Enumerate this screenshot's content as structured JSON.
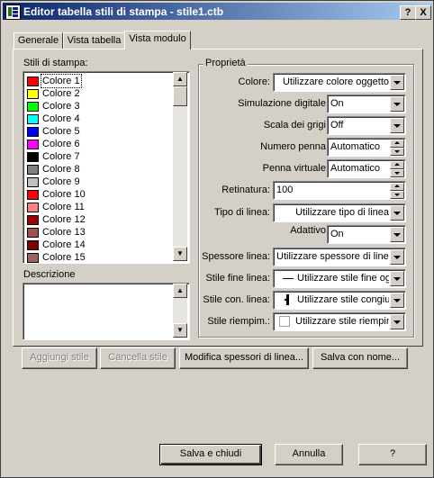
{
  "window": {
    "title": "Editor tabella stili di stampa - stile1.ctb",
    "help_button": "?",
    "close_button": "X"
  },
  "tabs": [
    {
      "label": "Generale"
    },
    {
      "label": "Vista tabella"
    },
    {
      "label": "Vista modulo"
    }
  ],
  "styles_list": {
    "label": "Stili di stampa:",
    "items": [
      {
        "label": "Colore 1",
        "color": "#ff0000",
        "selected": true
      },
      {
        "label": "Colore 2",
        "color": "#ffff00"
      },
      {
        "label": "Colore 3",
        "color": "#00ff00"
      },
      {
        "label": "Colore 4",
        "color": "#00ffff"
      },
      {
        "label": "Colore 5",
        "color": "#0000ff"
      },
      {
        "label": "Colore 6",
        "color": "#ff00ff"
      },
      {
        "label": "Colore 7",
        "color": "#000000"
      },
      {
        "label": "Colore 8",
        "color": "#808080"
      },
      {
        "label": "Colore 9",
        "color": "#c0c0c0"
      },
      {
        "label": "Colore 10",
        "color": "#ff0000"
      },
      {
        "label": "Colore 11",
        "color": "#ff8080"
      },
      {
        "label": "Colore 12",
        "color": "#a00000"
      },
      {
        "label": "Colore 13",
        "color": "#a05050"
      },
      {
        "label": "Colore 14",
        "color": "#800000"
      },
      {
        "label": "Colore 15",
        "color": "#a06060"
      }
    ]
  },
  "description": {
    "label": "Descrizione",
    "value": ""
  },
  "properties": {
    "group_title": "Proprietà",
    "color": {
      "label": "Colore:",
      "value": "Utilizzare colore oggetto"
    },
    "dithering": {
      "label": "Simulazione digitale:",
      "value": "On"
    },
    "grayscale": {
      "label": "Scala dei grigi:",
      "value": "Off"
    },
    "pen_number": {
      "label": "Numero penna:",
      "value": "Automatico"
    },
    "virtual_pen": {
      "label": "Penna virtuale:",
      "value": "Automatico"
    },
    "screening": {
      "label": "Retinatura:",
      "value": "100"
    },
    "linetype": {
      "label": "Tipo di linea:",
      "value": "Utilizzare tipo di linea"
    },
    "adaptive": {
      "label": "Adattivo:",
      "value": "On"
    },
    "lineweight": {
      "label": "Spessore linea:",
      "value": "Utilizzare spessore di linea"
    },
    "line_end": {
      "label": "Stile fine linea:",
      "value": "Utilizzare stile fine oggetto"
    },
    "line_join": {
      "label": "Stile con. linea:",
      "value": "Utilizzare stile congiunzione"
    },
    "fill": {
      "label": "Stile riempim.:",
      "value": "Utilizzare stile riempimento"
    }
  },
  "actions": {
    "add_style": "Aggiungi stile",
    "delete_style": "Cancella stile",
    "edit_lineweights": "Modifica spessori di linea...",
    "save_as": "Salva con nome..."
  },
  "footer": {
    "save_close": "Salva e chiudi",
    "cancel": "Annulla",
    "help": "?"
  }
}
